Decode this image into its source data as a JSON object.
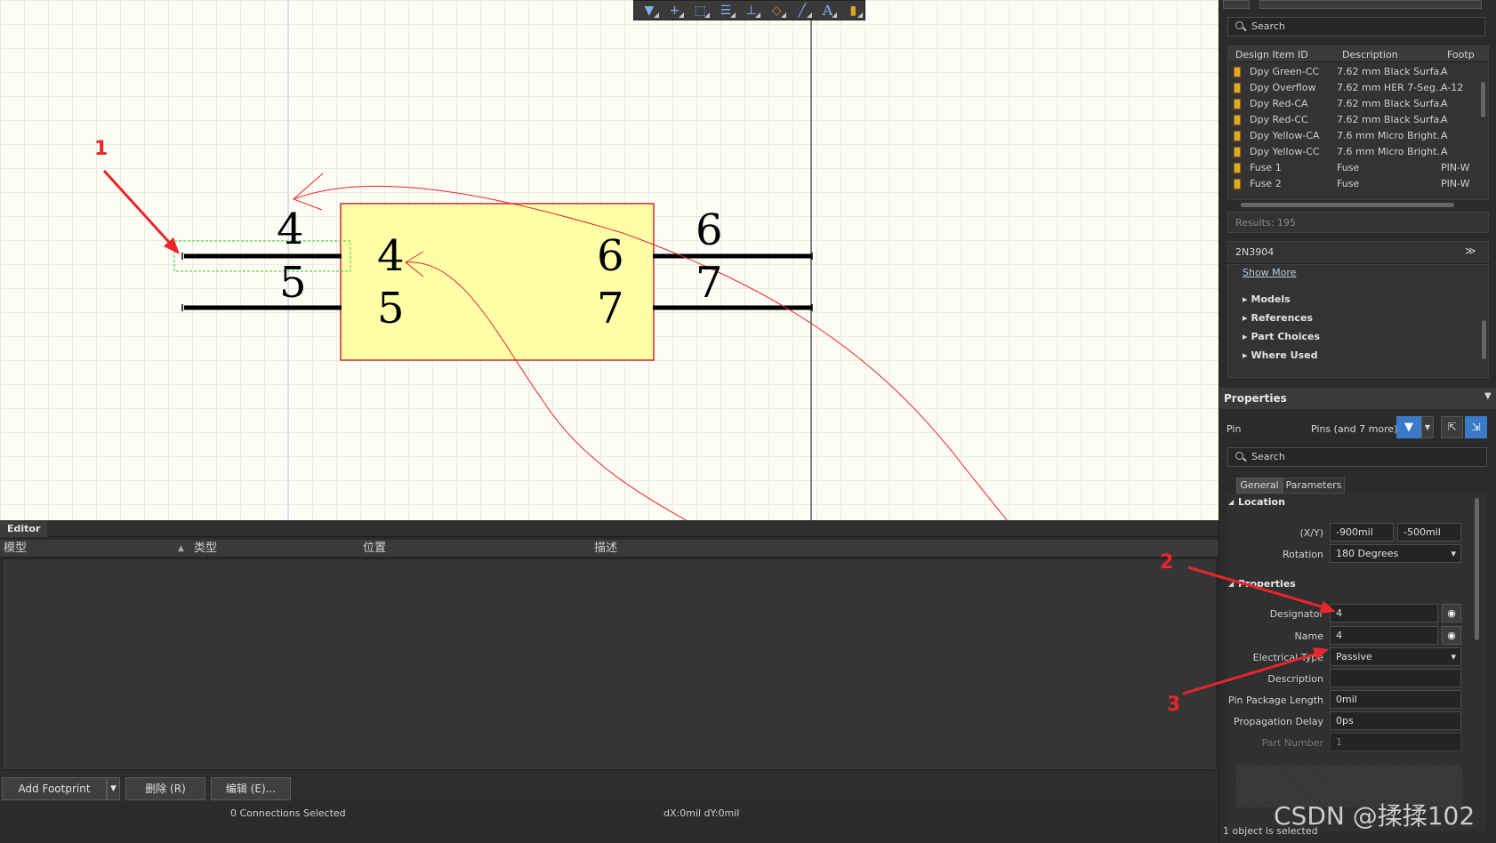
{
  "canvas": {
    "left_pins": [
      {
        "outer": "4",
        "inner": "4"
      },
      {
        "outer": "5",
        "inner": "5"
      }
    ],
    "right_pins": [
      {
        "outer": "6",
        "inner": "6"
      },
      {
        "outer": "7",
        "inner": "7"
      }
    ],
    "body_fill": "#ffffa8",
    "body_stroke": "#c03030",
    "selection_color": "#33cc33"
  },
  "toolbar": {
    "icons": [
      "filter-icon",
      "add-icon",
      "select-rect-icon",
      "align-icon",
      "pin-icon",
      "eraser-icon",
      "line-icon",
      "text-icon",
      "component-icon"
    ],
    "glyphs": [
      "▼",
      "+",
      "⬚",
      "☰",
      "⊥",
      "◇",
      "╱",
      "A",
      "▮"
    ]
  },
  "editor": {
    "tab_label": "Editor",
    "columns": [
      "模型",
      "类型",
      "位置",
      "描述"
    ],
    "buttons": {
      "add_footprint": "Add Footprint",
      "delete": "删除 (R)",
      "edit": "编辑 (E)..."
    }
  },
  "status": {
    "connections": "0 Connections Selected",
    "delta": "dX:0mil dY:0mil",
    "selection": "1 object is selected"
  },
  "library": {
    "search_placeholder": "Search",
    "columns": [
      "Design Item ID",
      "Description",
      "Footp"
    ],
    "rows": [
      {
        "id": "Dpy Green-CC",
        "desc": "7.62 mm Black Surfa...",
        "foot": "A"
      },
      {
        "id": "Dpy Overflow",
        "desc": "7.62 mm HER 7-Seg...",
        "foot": "A-12"
      },
      {
        "id": "Dpy Red-CA",
        "desc": "7.62 mm Black Surfa...",
        "foot": "A"
      },
      {
        "id": "Dpy Red-CC",
        "desc": "7.62 mm Black Surfa...",
        "foot": "A"
      },
      {
        "id": "Dpy Yellow-CA",
        "desc": "7.6 mm Micro Bright...",
        "foot": "A"
      },
      {
        "id": "Dpy Yellow-CC",
        "desc": "7.6 mm Micro Bright...",
        "foot": "A"
      },
      {
        "id": "Fuse 1",
        "desc": "Fuse",
        "foot": "PIN-W"
      },
      {
        "id": "Fuse 2",
        "desc": "Fuse",
        "foot": "PIN-W"
      }
    ],
    "results": "Results: 195"
  },
  "details": {
    "component": "2N3904",
    "show_more": "Show More",
    "tree": [
      "Models",
      "References",
      "Part Choices",
      "Where Used"
    ]
  },
  "properties": {
    "title": "Properties",
    "object_type": "Pin",
    "selection_summary": "Pins (and 7 more)",
    "search_placeholder": "Search",
    "tabs": [
      "General",
      "Parameters"
    ],
    "location_title": "Location",
    "xy_label": "(X/Y)",
    "x": "-900mil",
    "y": "-500mil",
    "rotation_label": "Rotation",
    "rotation": "180 Degrees",
    "properties_title": "Properties",
    "designator_label": "Designator",
    "designator": "4",
    "name_label": "Name",
    "name": "4",
    "electrical_type_label": "Electrical Type",
    "electrical_type": "Passive",
    "description_label": "Description",
    "description": "",
    "pin_length_label": "Pin Package Length",
    "pin_length": "0mil",
    "prop_delay_label": "Propagation Delay",
    "prop_delay": "0ps",
    "part_number_label": "Part Number",
    "part_number": "1"
  },
  "annotations": {
    "marker_1": "1",
    "marker_2": "2",
    "marker_3": "3",
    "watermark": "CSDN @揉揉102",
    "color": "#e8262b"
  }
}
